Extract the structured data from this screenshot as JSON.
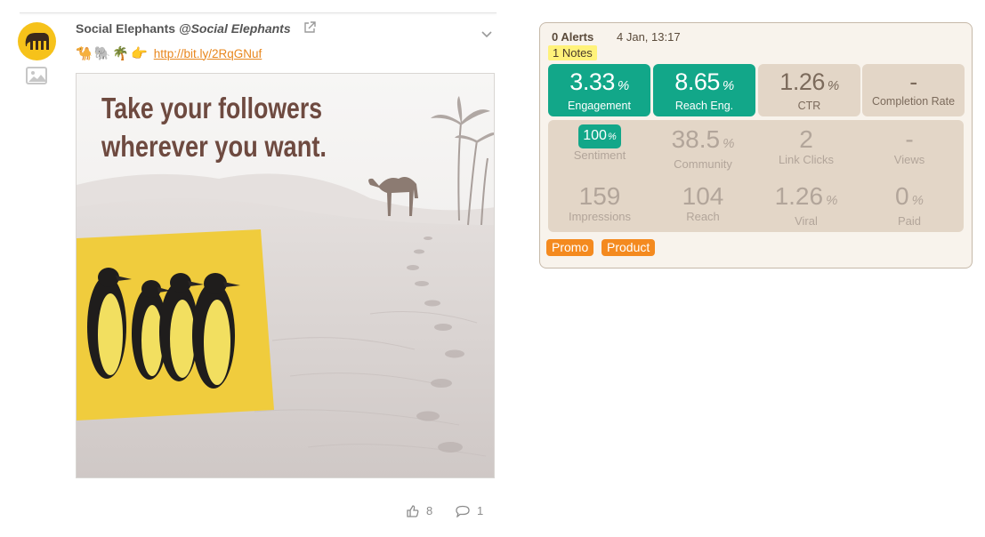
{
  "post": {
    "account_name": "Social Elephants",
    "account_handle": "@Social Elephants",
    "emojis": "🐪🐘🌴👉",
    "link_text": "http://bit.ly/2RqGNuf",
    "image_headline_line1": "Take your followers",
    "image_headline_line2": "wherever you want.",
    "likes": "8",
    "comments": "1"
  },
  "icons": {
    "avatar": "elephant-logo",
    "image_toggle": "image-icon",
    "external_link": "external-link-icon",
    "expand": "chevron-down-icon",
    "like": "thumbs-up-icon",
    "comment": "comment-icon"
  },
  "panel": {
    "alerts": "0 Alerts",
    "date": "4 Jan, 13:17",
    "notes": "1 Notes",
    "top_metrics": [
      {
        "value": "3.33",
        "unit": "%",
        "label": "Engagement",
        "style": "green"
      },
      {
        "value": "8.65",
        "unit": "%",
        "label": "Reach Eng.",
        "style": "green"
      },
      {
        "value": "1.26",
        "unit": "%",
        "label": "CTR",
        "style": "beige"
      },
      {
        "value": "-",
        "unit": "",
        "label": "Completion Rate",
        "style": "beige"
      }
    ],
    "sentiment": {
      "value": "100",
      "unit": "%",
      "label": "Sentiment"
    },
    "community": {
      "value": "38.5",
      "unit": "%",
      "label": "Community"
    },
    "link_clicks": {
      "value": "2",
      "label": "Link Clicks"
    },
    "views": {
      "value": "-",
      "label": "Views"
    },
    "impressions": {
      "value": "159",
      "label": "Impressions"
    },
    "reach": {
      "value": "104",
      "label": "Reach"
    },
    "viral": {
      "value": "1.26",
      "unit": "%",
      "label": "Viral"
    },
    "paid": {
      "value": "0",
      "unit": "%",
      "label": "Paid"
    },
    "tags": [
      "Promo",
      "Product"
    ]
  },
  "colors": {
    "accent_green": "#12a789",
    "panel_bg": "#f8f3ec",
    "tile_beige": "#e3d6c7",
    "tag_orange": "#f48a1f",
    "notes_highlight": "#fff27a",
    "link_orange": "#e8871e",
    "brand_yellow": "#f6c21a"
  }
}
